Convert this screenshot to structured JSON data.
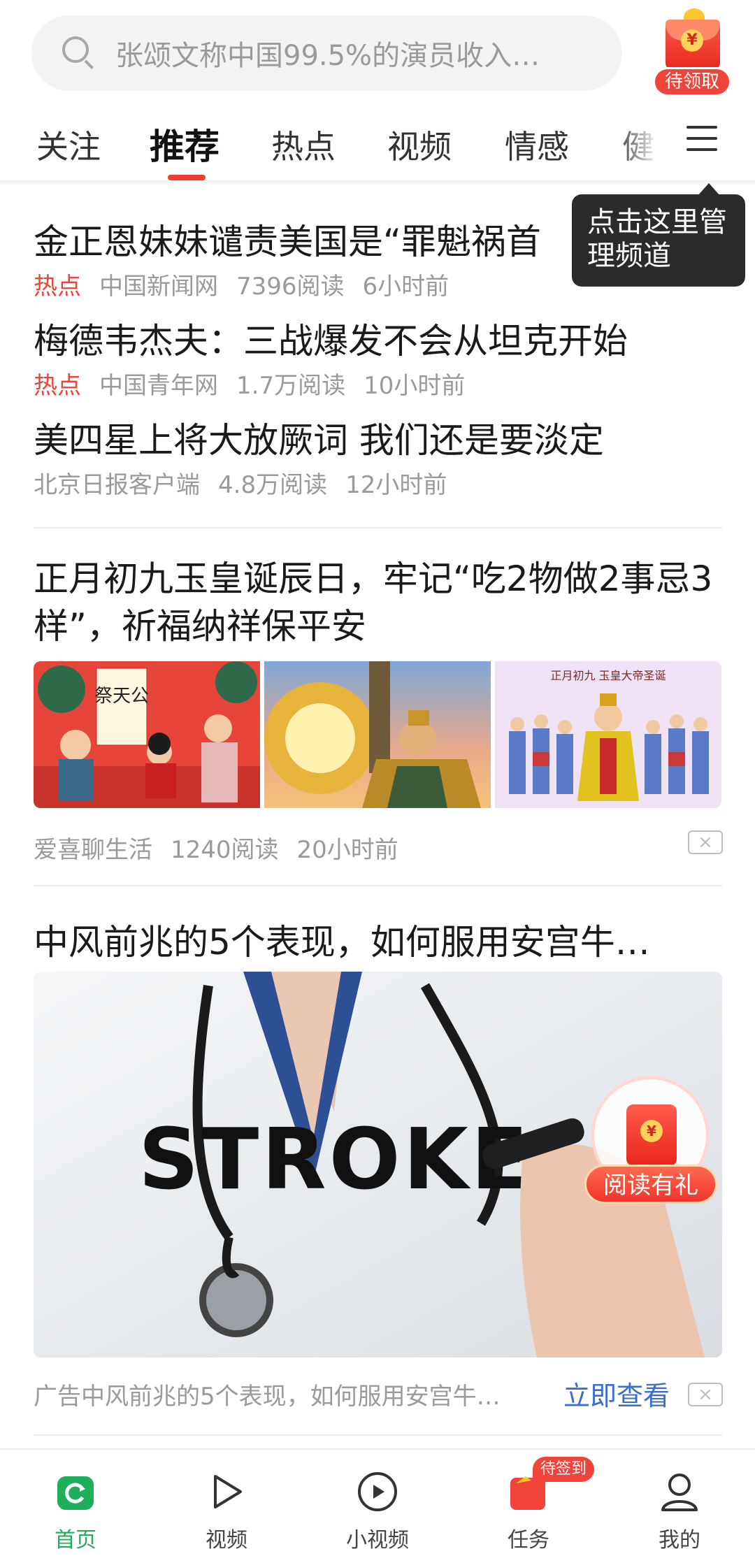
{
  "search": {
    "placeholder": "张颂文称中国99.5%的演员收入…"
  },
  "top_reward": {
    "badge": "待领取",
    "yen": "¥"
  },
  "tabs": [
    {
      "label": "关注",
      "active": false
    },
    {
      "label": "推荐",
      "active": true
    },
    {
      "label": "热点",
      "active": false
    },
    {
      "label": "视频",
      "active": false
    },
    {
      "label": "情感",
      "active": false
    },
    {
      "label": "健",
      "active": false
    }
  ],
  "tooltip": {
    "text": "点击这里管理频道"
  },
  "feed": {
    "news": [
      {
        "title": "金正恩妹妹谴责美国是“罪魁祸首",
        "tag": "热点",
        "source": "中国新闻网",
        "reads": "7396阅读",
        "time": "6小时前"
      },
      {
        "title": "梅德韦杰夫：三战爆发不会从坦克开始",
        "tag": "热点",
        "source": "中国青年网",
        "reads": "1.7万阅读",
        "time": "10小时前"
      },
      {
        "title": "美四星上将大放厥词 我们还是要淡定",
        "tag": "",
        "source": "北京日报客户端",
        "reads": "4.8万阅读",
        "time": "12小时前"
      }
    ],
    "article": {
      "title": "正月初九玉皇诞辰日，牢记“吃2物做2事忌3样”，祈福纳祥保平安",
      "thumbs": [
        "festival-illustration",
        "jade-emperor-statue",
        "jade-emperor-painting"
      ],
      "thumb_caption_1": "祭天公",
      "thumb_caption_3": "正月初九 玉皇大帝圣诞",
      "source": "爱喜聊生活",
      "reads": "1240阅读",
      "time": "20小时前",
      "close": "×"
    },
    "ad": {
      "title": "中风前兆的5个表现，如何服用安宫牛…",
      "image_text": "STROKE",
      "label": "广告",
      "desc": "中风前兆的5个表现，如何服用安宫牛…",
      "cta": "立即查看",
      "close": "×"
    }
  },
  "floating_reward": {
    "label": "阅读有礼",
    "yen": "¥"
  },
  "bottom_nav": [
    {
      "label": "首页",
      "icon": "home-refresh-icon",
      "active": true
    },
    {
      "label": "视频",
      "icon": "play-icon",
      "active": false
    },
    {
      "label": "小视频",
      "icon": "small-video-icon",
      "active": false
    },
    {
      "label": "任务",
      "icon": "task-envelope-icon",
      "active": false,
      "badge": "待签到"
    },
    {
      "label": "我的",
      "icon": "user-icon",
      "active": false
    }
  ],
  "colors": {
    "accent_red": "#f0443a",
    "active_green": "#1eaf5a",
    "link_blue": "#3b6ec9"
  }
}
